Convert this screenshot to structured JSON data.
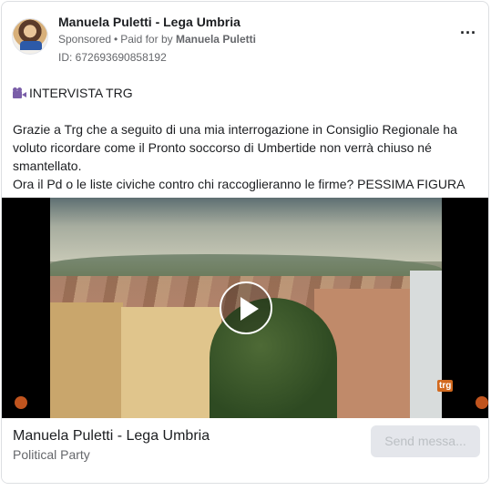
{
  "header": {
    "page_name": "Manuela Puletti - Lega Umbria",
    "sponsored": "Sponsored",
    "paid_for_by_label": "Paid for by",
    "paid_for_by": "Manuela Puletti",
    "ad_id": "ID: 672693690858192",
    "more_icon": "ellipsis-icon"
  },
  "post": {
    "label": "INTERVISTA TRG",
    "label_icon": "video-camera-icon",
    "body_line1": "Grazie a Trg che a seguito di una mia interrogazione in Consiglio Regionale ha voluto ricordare come il Pronto soccorso di Umbertide non verrà chiuso né smantellato.",
    "body_line2": "Ora il Pd o le liste civiche contro chi raccoglieranno le firme? PESSIMA FIGURA"
  },
  "video": {
    "play_icon": "play-icon",
    "watermark": "trg"
  },
  "footer": {
    "title": "Manuela Puletti - Lega Umbria",
    "subtitle": "Political Party",
    "button_label": "Send messa..."
  }
}
